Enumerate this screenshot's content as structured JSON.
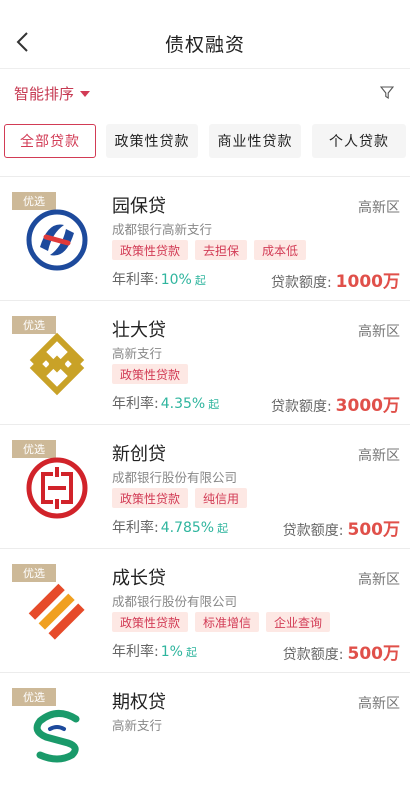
{
  "header": {
    "title": "债权融资",
    "back_icon": "chevron-left-icon"
  },
  "sort": {
    "label": "智能排序",
    "filter_icon": "funnel-icon"
  },
  "tabs": [
    {
      "label": "全部贷款",
      "active": true
    },
    {
      "label": "政策性贷款",
      "active": false
    },
    {
      "label": "商业性贷款",
      "active": false
    },
    {
      "label": "个人贷款",
      "active": false
    }
  ],
  "products": [
    {
      "badge": "优选",
      "name": "园保贷",
      "region": "高新区",
      "bank": "成都银行高新支行",
      "tags": [
        "政策性贷款",
        "去担保",
        "成本低"
      ],
      "rate_label": "年利率:",
      "rate": "10%",
      "rate_suffix": "起",
      "amount_label": "贷款额度:",
      "amount": "1000万",
      "logo_icon": "blue-red-circle-logo-icon"
    },
    {
      "badge": "优选",
      "name": "壮大贷",
      "region": "高新区",
      "bank": "高新支行",
      "tags": [
        "政策性贷款"
      ],
      "rate_label": "年利率:",
      "rate": "4.35%",
      "rate_suffix": "起",
      "amount_label": "贷款额度:",
      "amount": "3000万",
      "logo_icon": "gold-square-knot-logo-icon"
    },
    {
      "badge": "优选",
      "name": "新创贷",
      "region": "高新区",
      "bank": "成都银行股份有限公司",
      "tags": [
        "政策性贷款",
        "纯信用"
      ],
      "rate_label": "年利率:",
      "rate": "4.785%",
      "rate_suffix": "起",
      "amount_label": "贷款额度:",
      "amount": "500万",
      "logo_icon": "icbc-red-logo-icon"
    },
    {
      "badge": "优选",
      "name": "成长贷",
      "region": "高新区",
      "bank": "成都银行股份有限公司",
      "tags": [
        "政策性贷款",
        "标准增信",
        "企业查询"
      ],
      "rate_label": "年利率:",
      "rate": "1%",
      "rate_suffix": "起",
      "amount_label": "贷款额度:",
      "amount": "500万",
      "logo_icon": "orange-stripes-logo-icon"
    },
    {
      "badge": "优选",
      "name": "期权贷",
      "region": "高新区",
      "bank": "高新支行",
      "tags": [],
      "rate_label": "",
      "rate": "",
      "rate_suffix": "",
      "amount_label": "",
      "amount": "",
      "logo_icon": "green-s-logo-icon"
    }
  ],
  "colors": {
    "accent": "#d23b55",
    "rate": "#2fb59e",
    "amount": "#e0504a",
    "badge": "#cdb998"
  }
}
